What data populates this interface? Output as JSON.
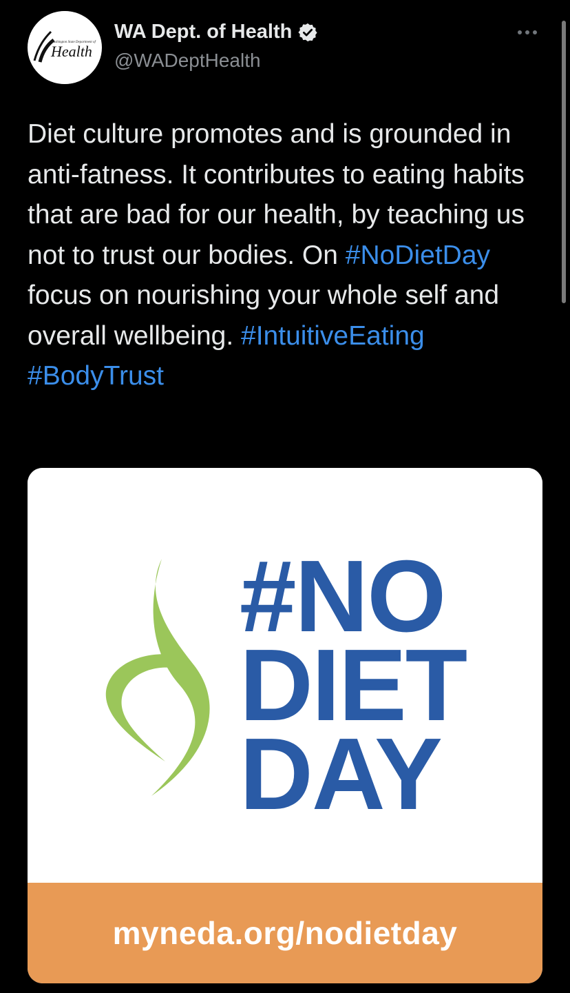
{
  "author": {
    "avatar_logo": {
      "small_text": "Washington State Department of",
      "main_text": "Health"
    },
    "display_name": "WA Dept. of Health",
    "handle": "@WADeptHealth",
    "verified_icon": "verified-badge-icon"
  },
  "menu": {
    "more_icon": "more-horizontal-icon"
  },
  "tweet": {
    "text_1": "Diet culture promotes and is grounded in anti-fatness. It contributes to eating habits that are bad for our health, by teaching us not to trust our bodies. On ",
    "hashtag_1": "#NoDietDay",
    "text_2": " focus on nourishing your whole self and overall wellbeing. ",
    "hashtag_2": "#IntuitiveEating",
    "text_3": " ",
    "hashtag_3": "#BodyTrust"
  },
  "card": {
    "logo_line_1": "#NO",
    "logo_line_2": "DIET",
    "logo_line_3": "DAY",
    "leaf_icon": "green-leaf-swoosh-icon",
    "url": "myneda.org/nodietday",
    "colors": {
      "logo_blue": "#2a5ba6",
      "leaf_green": "#9bc65a",
      "footer_orange": "#e89a55"
    }
  },
  "colors": {
    "background": "#000000",
    "text": "#e7e9ea",
    "handle": "#8b8f94",
    "link": "#3b8eea"
  }
}
